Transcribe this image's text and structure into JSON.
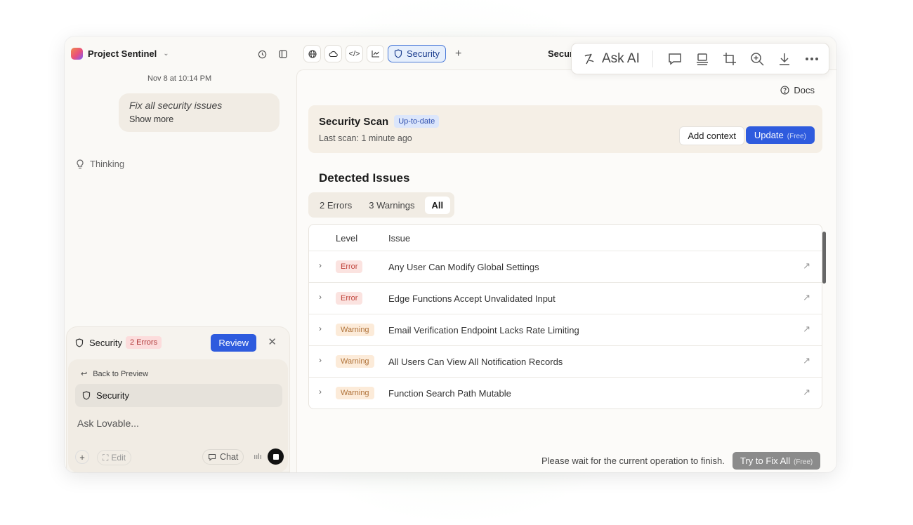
{
  "project": {
    "name": "Project Sentinel"
  },
  "chat": {
    "date": "Nov 8 at 10:14 PM",
    "user_message": "Fix all security issues",
    "show_more": "Show more",
    "thinking": "Thinking"
  },
  "composer": {
    "title": "Security",
    "errors_badge": "2 Errors",
    "review": "Review",
    "back": "Back to Preview",
    "chip": "Security",
    "placeholder": "Ask Lovable...",
    "edit": "Edit",
    "chat": "Chat"
  },
  "top_tabs": {
    "active_label": "Security",
    "header_label": "Securi"
  },
  "panel": {
    "docs": "Docs",
    "scan_title": "Security Scan",
    "scan_badge": "Up-to-date",
    "scan_sub": "Last scan: 1 minute ago",
    "add_context": "Add context",
    "update": "Update",
    "update_free": "(Free)",
    "detected": "Detected Issues",
    "filters": [
      "2 Errors",
      "3 Warnings",
      "All"
    ],
    "col_level": "Level",
    "col_issue": "Issue",
    "rows": [
      {
        "level": "Error",
        "type": "error",
        "issue": "Any User Can Modify Global Settings"
      },
      {
        "level": "Error",
        "type": "error",
        "issue": "Edge Functions Accept Unvalidated Input"
      },
      {
        "level": "Warning",
        "type": "warning",
        "issue": "Email Verification Endpoint Lacks Rate Limiting"
      },
      {
        "level": "Warning",
        "type": "warning",
        "issue": "All Users Can View All Notification Records"
      },
      {
        "level": "Warning",
        "type": "warning",
        "issue": "Function Search Path Mutable"
      }
    ],
    "wait": "Please wait for the current operation to finish.",
    "fix_all": "Try to Fix All",
    "fix_free": "(Free)"
  },
  "askbar": {
    "label": "Ask AI"
  },
  "colors": {
    "accent": "#2e5bde",
    "error": "#c0453c",
    "warning": "#b0733a"
  }
}
